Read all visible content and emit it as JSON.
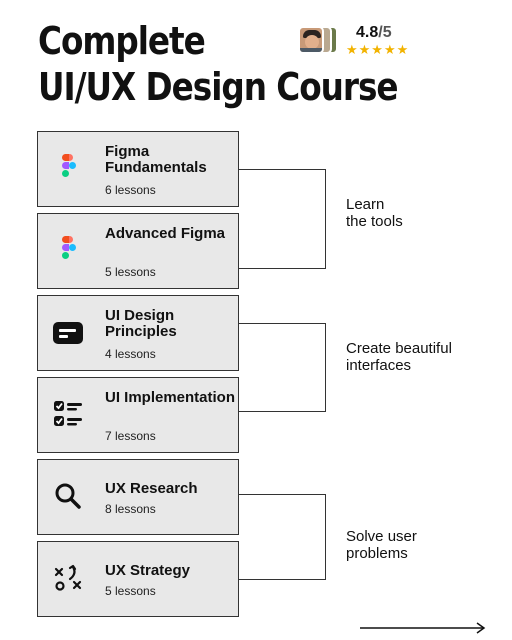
{
  "course": {
    "title_line1": "Complete",
    "title_line2": "UI/UX Design Course"
  },
  "rating": {
    "score": "4.8",
    "max": "/5",
    "stars": "★★★★★",
    "star_color": "#f2b300"
  },
  "modules": [
    {
      "name": "Figma Fundamentals",
      "lessons": "6 lessons",
      "icon": "figma-icon"
    },
    {
      "name": "Advanced Figma",
      "lessons": "5 lessons",
      "icon": "figma-icon"
    },
    {
      "name": "UI Design Principles",
      "lessons": "4 lessons",
      "icon": "card-layout-icon"
    },
    {
      "name": "UI Implementation",
      "lessons": "7 lessons",
      "icon": "checklist-icon"
    },
    {
      "name": "UX Research",
      "lessons": "8 lessons",
      "icon": "search-icon"
    },
    {
      "name": "UX Strategy",
      "lessons": "5 lessons",
      "icon": "strategy-icon"
    }
  ],
  "groups": [
    {
      "label_line1": "Learn",
      "label_line2": "the tools"
    },
    {
      "label_line1": "Create beautiful",
      "label_line2": "interfaces"
    },
    {
      "label_line1": "Solve user",
      "label_line2": "problems"
    }
  ],
  "colors": {
    "card_bg": "#e8e8e8",
    "border": "#333333",
    "figma_red": "#f24e1e",
    "figma_orange": "#ff7262",
    "figma_purple": "#a259ff",
    "figma_blue": "#1abcfe",
    "figma_green": "#0acf83"
  }
}
